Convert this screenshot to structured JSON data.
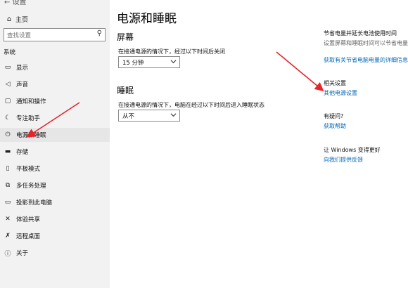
{
  "sidebar": {
    "back_label": "← 设置",
    "home": {
      "label": "主页",
      "icon": "home-icon"
    },
    "search": {
      "placeholder": "查找设置",
      "icon": "search-icon"
    },
    "section": "系统",
    "items": [
      {
        "label": "显示",
        "icon": "monitor-icon"
      },
      {
        "label": "声音",
        "icon": "speaker-icon"
      },
      {
        "label": "通知和操作",
        "icon": "notification-icon"
      },
      {
        "label": "专注助手",
        "icon": "moon-icon"
      },
      {
        "label": "电源和睡眠",
        "icon": "power-icon"
      },
      {
        "label": "存储",
        "icon": "storage-icon"
      },
      {
        "label": "平板模式",
        "icon": "tablet-icon"
      },
      {
        "label": "多任务处理",
        "icon": "multitask-icon"
      },
      {
        "label": "投影到此电脑",
        "icon": "project-icon"
      },
      {
        "label": "体验共享",
        "icon": "share-icon"
      },
      {
        "label": "远程桌面",
        "icon": "remote-icon"
      },
      {
        "label": "关于",
        "icon": "info-icon"
      }
    ]
  },
  "main": {
    "title": "电源和睡眠",
    "screen": {
      "title": "屏幕",
      "label": "在接通电源的情况下，经过以下时间后关闭",
      "value": "15 分钟"
    },
    "sleep": {
      "title": "睡眠",
      "label": "在接通电源的情况下，电脑在经过以下时间后进入睡眠状态",
      "value": "从不"
    }
  },
  "related": {
    "battery_head": "节省电量并延长电池使用时间",
    "battery_text_1": "设置屏幕和睡眠时间可以节省电量。",
    "battery_link": "获取有关节省电脑电量的详细信息",
    "related_head": "相关设置",
    "power_link": "其他电源设置",
    "question_head": "有疑问?",
    "help_link": "获取帮助",
    "windows_head": "让 Windows 变得更好",
    "feedback_link": "向我们提供反馈"
  },
  "colors": {
    "link": "#0067b8",
    "arrow": "#e8242b",
    "sidebar_bg": "#f2f2f2"
  }
}
